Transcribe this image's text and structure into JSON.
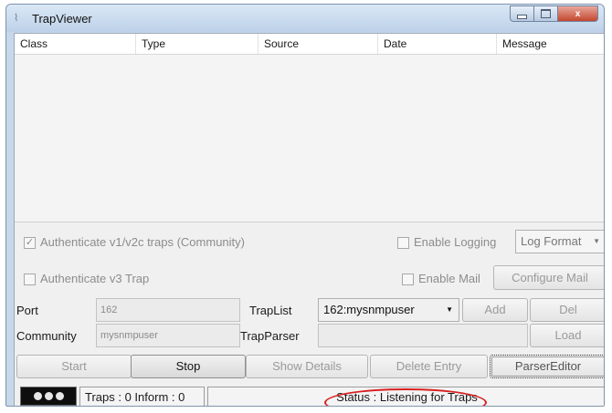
{
  "window": {
    "title": "TrapViewer",
    "icons": {
      "app": "antenna-icon",
      "minimize": "minimize-icon",
      "maximize": "maximize-icon",
      "close": "close-icon"
    },
    "close_glyph": "x"
  },
  "table": {
    "columns": [
      "Class",
      "Type",
      "Source",
      "Date",
      "Message"
    ],
    "rows": []
  },
  "options": {
    "auth_v1v2": {
      "label": "Authenticate v1/v2c traps (Community)",
      "checked": true,
      "enabled": false
    },
    "auth_v3": {
      "label": "Authenticate v3 Trap",
      "checked": false,
      "enabled": false
    },
    "enable_logging": {
      "label": "Enable Logging",
      "checked": false,
      "enabled": false
    },
    "log_format": {
      "value": "Log Format"
    },
    "enable_mail": {
      "label": "Enable Mail",
      "checked": false,
      "enabled": false
    },
    "configure_mail": "Configure Mail"
  },
  "config": {
    "port_label": "Port",
    "port_value": "162",
    "community_label": "Community",
    "community_value": "mysnmpuser",
    "traplist_label": "TrapList",
    "traplist_value": "162:mysnmpuser",
    "add_label": "Add",
    "del_label": "Del",
    "trapparser_label": "TrapParser",
    "trapparser_value": "",
    "load_label": "Load"
  },
  "actions": {
    "start": "Start",
    "stop": "Stop",
    "show_details": "Show Details",
    "delete_entry": "Delete Entry",
    "parser_editor": "ParserEditor"
  },
  "status": {
    "counts": "Traps : 0 Inform : 0",
    "message": "Status : Listening for Traps",
    "highlight_color": "#d81f1f"
  }
}
